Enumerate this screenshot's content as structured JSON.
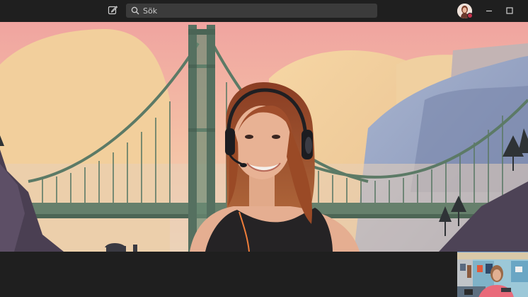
{
  "header": {
    "search_placeholder": "Sök",
    "icons": {
      "compose": "compose-icon",
      "search": "search-icon",
      "minimize": "minimize-icon",
      "maximize": "maximize-icon"
    },
    "presence_status_color": "#c4314b"
  },
  "colors": {
    "chrome_background": "#1f1f1f",
    "search_background": "#3b3b3b",
    "self_view_border": "#6b9bd1"
  }
}
